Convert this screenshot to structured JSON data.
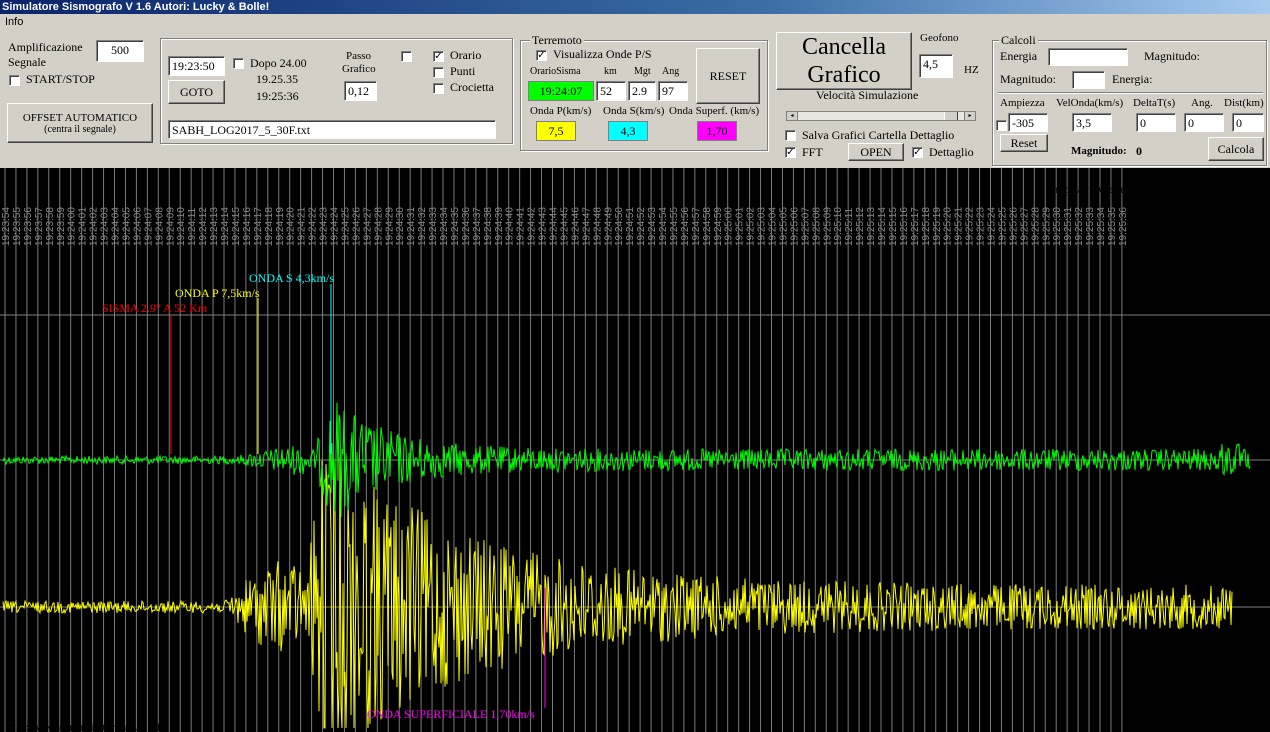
{
  "window": {
    "title": "Simulatore Sismografo V 1.6  Autori: Lucky & Bolle!"
  },
  "menu": [
    "Info"
  ],
  "controls": {
    "amplificazione_label_1": "Amplificazione",
    "amplificazione_label_2": "Segnale",
    "amplificazione_value": "500",
    "start_stop_label": "START/STOP",
    "offset_button_line1": "OFFSET AUTOMATICO",
    "offset_button_line2": "(centra il segnale)",
    "time_value": "19:23:50",
    "dopo_label": "Dopo 24.00",
    "time_a": "19.25.35",
    "time_b": "19:25:36",
    "goto_label": "GOTO",
    "passo_label_1": "Passo",
    "passo_label_2": "Grafico",
    "passo_value": "0,12",
    "orario_label": "Orario",
    "punti_label": "Punti",
    "crocietta_label": "Crocietta",
    "file_name": "SABH_LOG2017_5_30F.txt"
  },
  "terremoto": {
    "title": "Terremoto",
    "visualizza_label": "Visualizza Onde P/S",
    "col_orario": "OrarioSisma",
    "col_km": "km",
    "col_mgt": "Mgt",
    "col_ang": "Ang",
    "orario_value": "19:24:07",
    "km_value": "52",
    "mgt_value": "2.9",
    "ang_value": "97",
    "reset_label": "RESET",
    "onda_p_label": "Onda P(km/s)",
    "onda_s_label": "Onda S(km/s)",
    "onda_sup_label": "Onda Superf. (km/s)",
    "onda_p_value": "7,5",
    "onda_s_value": "4,3",
    "onda_sup_value": "1,70",
    "color_p": "#ffff00",
    "color_s": "#00ffff",
    "color_sup": "#ff00ff",
    "color_orario": "#00ff00"
  },
  "grafico": {
    "cancella_line1": "Cancella",
    "cancella_line2": "Grafico",
    "geofono_label": "Geofono",
    "geofono_value": "4,5",
    "hz_label": "HZ",
    "velocita_label": "Velocità Simulazione",
    "slider_value": 0.93,
    "salva_label": "Salva Grafici Cartella Dettaglio",
    "fft_label": "FFT",
    "open_label": "OPEN",
    "dettaglio_label": "Dettaglio"
  },
  "calcoli": {
    "title": "Calcoli",
    "energia_label": "Energia",
    "magnitudo_label": "Magnitudo:",
    "magnitudo_label_2": "Magnitudo:",
    "energia_label_2": "Energia:",
    "col_ampiezza": "Ampiezza",
    "col_velonda": "VelOnda(km/s)",
    "col_deltat": "DeltaT(s)",
    "col_ang": "Ang.",
    "col_dist": "Dist(km)",
    "ampiezza_value": "-305",
    "velonda_value": "3,5",
    "deltat_value": "0",
    "ang_value": "0",
    "dist_value": "0",
    "reset_label": "Reset",
    "magnitudo_result_label": "Magnitudo:",
    "magnitudo_result_value": "0",
    "calcola_label": "Calcola"
  },
  "seismograph": {
    "website_top": "http://www.energialternativa.info",
    "website_bottom": "http://www.energialternativa.info",
    "sisma_label": "SISMA 2.9° A 52 Km",
    "onda_p_label": "ONDA P 7,5km/s",
    "onda_s_label": "ONDA S 4,3km/s",
    "onda_sup_label": "ONDA SUPERFICIALE 1,70km/s",
    "color_sisma": "#ff0000",
    "color_p": "#ffff00",
    "color_s": "#00ffff",
    "color_sup": "#ff00ff",
    "color_trace_top": "#00ff00",
    "color_trace_bottom": "#ffff00",
    "time_labels": [
      "19:23:54",
      "19:23:55",
      "19:23:56",
      "19:23:57",
      "19:23:58",
      "19:23:59",
      "19:24:00",
      "19:24:01",
      "19:24:02",
      "19:24:03",
      "19:24:04",
      "19:24:05",
      "19:24:06",
      "19:24:07",
      "19:24:08",
      "19:24:09",
      "19:24:10",
      "19:24:11",
      "19:24:12",
      "19:24:13",
      "19:24:14",
      "19:24:15",
      "19:24:16",
      "19:24:17",
      "19:24:18",
      "19:24:19",
      "19:24:20",
      "19:24:21",
      "19:24:22",
      "19:24:23",
      "19:24:24",
      "19:24:25",
      "19:24:26",
      "19:24:27",
      "19:24:28",
      "19:24:29",
      "19:24:30",
      "19:24:31",
      "19:24:32",
      "19:24:33",
      "19:24:34",
      "19:24:35",
      "19:24:36",
      "19:24:37",
      "19:24:38",
      "19:24:39",
      "19:24:40",
      "19:24:41",
      "19:24:42",
      "19:24:43",
      "19:24:44",
      "19:24:45",
      "19:24:46",
      "19:24:47",
      "19:24:48",
      "19:24:49",
      "19:24:50",
      "19:24:51",
      "19:24:52",
      "19:24:53",
      "19:24:54",
      "19:24:55",
      "19:24:56",
      "19:24:57",
      "19:24:58",
      "19:24:59",
      "19:25:00",
      "19:25:01",
      "19:25:02",
      "19:25:03",
      "19:25:04",
      "19:25:05",
      "19:25:06",
      "19:25:07",
      "19:25:08",
      "19:25:09",
      "19:25:10",
      "19:25:11",
      "19:25:12",
      "19:25:13",
      "19:25:14",
      "19:25:15",
      "19:25:16",
      "19:25:17",
      "19:25:18",
      "19:25:19",
      "19:25:20",
      "19:25:21",
      "19:25:22",
      "19:25:23",
      "19:25:24",
      "19:25:25",
      "19:25:26",
      "19:25:27",
      "19:25:28",
      "19:25:29",
      "19:25:30",
      "19:25:31",
      "19:25:32",
      "19:25:33",
      "19:25:34",
      "19:25:35",
      "19:25:36"
    ]
  }
}
